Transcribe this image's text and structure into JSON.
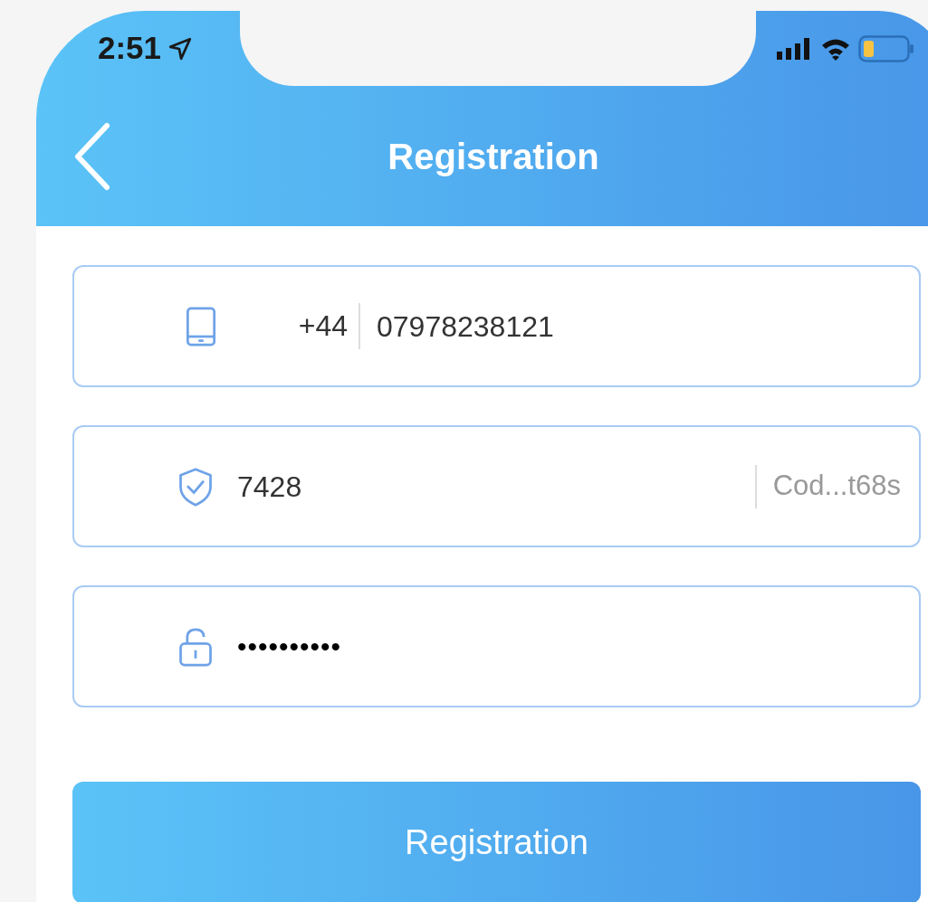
{
  "status_bar": {
    "time": "2:51"
  },
  "nav": {
    "title": "Registration"
  },
  "fields": [
    {
      "kind": "phone",
      "country_code": "+44",
      "value": "07978238121"
    },
    {
      "kind": "code",
      "value": "7428",
      "action": "Cod...t68s"
    },
    {
      "kind": "password",
      "value": "••••••••••"
    }
  ],
  "submit": {
    "label": "Registration"
  }
}
